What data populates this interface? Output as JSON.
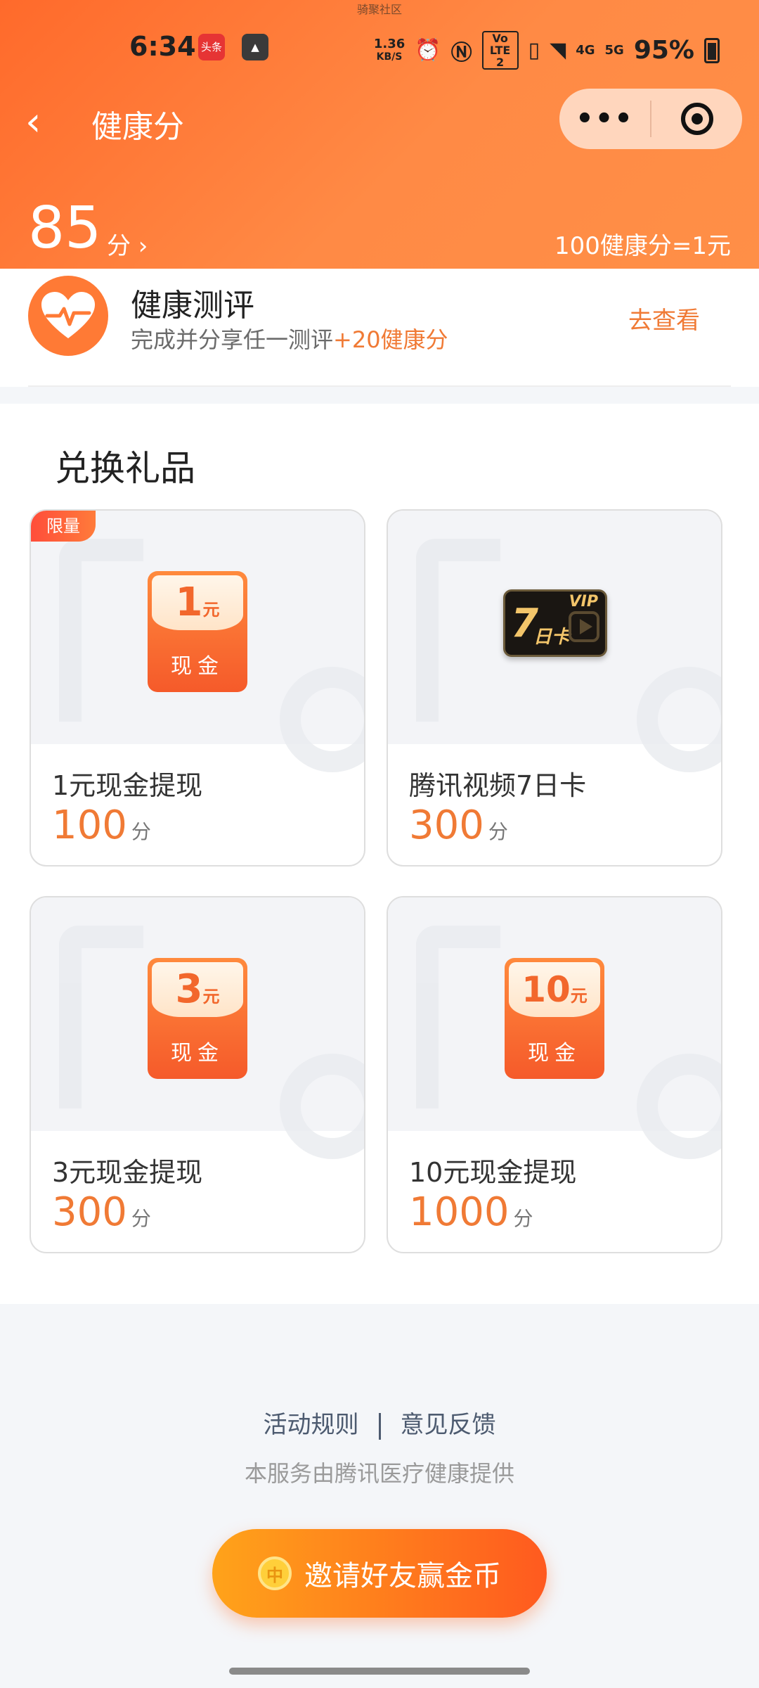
{
  "statusbar": {
    "top_text": "骑聚社区",
    "time": "6:34",
    "app1": "头条",
    "speed_value": "1.36",
    "speed_unit": "KB/S",
    "volte": "Vo LTE 2",
    "net4g": "4G",
    "net5g": "5G",
    "battery": "95%"
  },
  "nav": {
    "title": "健康分",
    "more": "•••"
  },
  "score": {
    "value": "85",
    "unit": "分 ›",
    "rate": "100健康分=1元"
  },
  "evaluation": {
    "title": "健康测评",
    "desc": "完成并分享任一测评",
    "bonus": "+20健康分",
    "action": "去查看"
  },
  "gifts": {
    "title": "兑换礼品",
    "items": [
      {
        "tag": "限量",
        "amount": "1",
        "yuan": "元",
        "cash": "现金",
        "name": "1元现金提现",
        "points": "100",
        "unit": "分"
      },
      {
        "vip_num": "7",
        "vip_day": "日卡",
        "vip_tag": "VIP",
        "name": "腾讯视频7日卡",
        "points": "300",
        "unit": "分"
      },
      {
        "amount": "3",
        "yuan": "元",
        "cash": "现金",
        "name": "3元现金提现",
        "points": "300",
        "unit": "分"
      },
      {
        "amount": "10",
        "yuan": "元",
        "cash": "现金",
        "name": "10元现金提现",
        "points": "1000",
        "unit": "分"
      }
    ]
  },
  "footer": {
    "rules": "活动规则",
    "feedback": "意见反馈",
    "note": "本服务由腾讯医疗健康提供",
    "invite": "邀请好友赢金币"
  },
  "colors": {
    "accent": "#ff7a35",
    "header_start": "#ff6a2b",
    "header_end": "#ff8f47"
  }
}
